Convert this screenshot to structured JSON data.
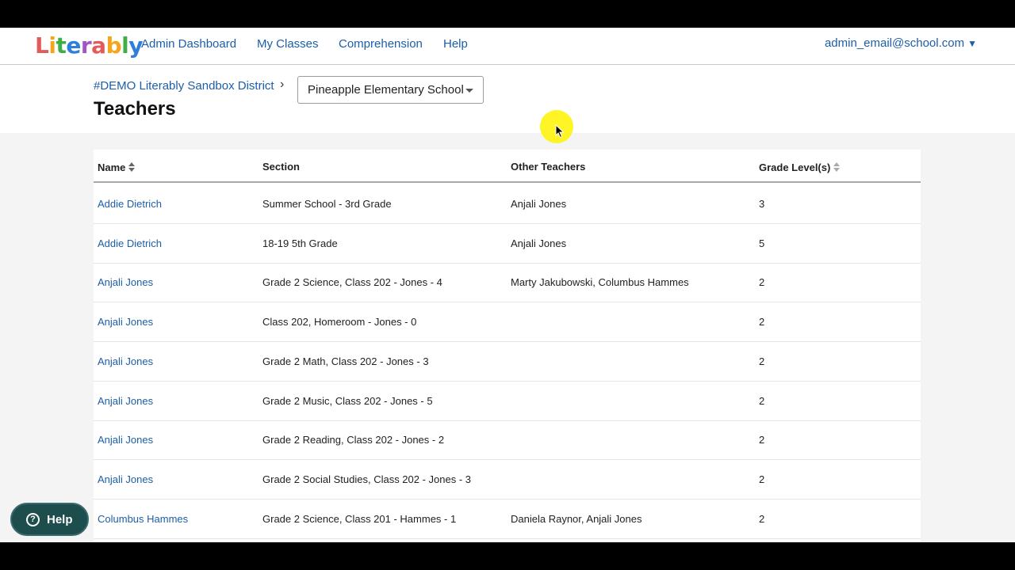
{
  "brand": {
    "logo_letters": [
      "L",
      "i",
      "t",
      "e",
      "r",
      "a",
      "b",
      "l",
      "y"
    ],
    "logo_colors": [
      "#e25b5b",
      "#f4a51c",
      "#3fae49",
      "#2f7ed8",
      "#a355c4",
      "#e25b5b",
      "#f4a51c",
      "#3fae49",
      "#2f7ed8"
    ]
  },
  "nav": {
    "admin_dashboard": "Admin Dashboard",
    "my_classes": "My Classes",
    "comprehension": "Comprehension",
    "help": "Help",
    "account": "admin_email@school.com"
  },
  "header": {
    "breadcrumb": "#DEMO Literably Sandbox District",
    "separator": "›",
    "school_selected": "Pineapple Elementary School",
    "title": "Teachers"
  },
  "table": {
    "columns": [
      "Name",
      "Section",
      "Other Teachers",
      "Grade Level(s)"
    ],
    "rows": [
      {
        "name": "Addie Dietrich",
        "section": "Summer School - 3rd Grade",
        "others": "Anjali Jones",
        "grade": "3"
      },
      {
        "name": "Addie Dietrich",
        "section": "18-19 5th Grade",
        "others": "Anjali Jones",
        "grade": "5"
      },
      {
        "name": "Anjali Jones",
        "section": "Grade 2 Science, Class 202 - Jones - 4",
        "others": "Marty Jakubowski, Columbus Hammes",
        "grade": "2"
      },
      {
        "name": "Anjali Jones",
        "section": "Class 202, Homeroom - Jones - 0",
        "others": "",
        "grade": "2"
      },
      {
        "name": "Anjali Jones",
        "section": "Grade 2 Math, Class 202 - Jones - 3",
        "others": "",
        "grade": "2"
      },
      {
        "name": "Anjali Jones",
        "section": "Grade 2 Music, Class 202 - Jones - 5",
        "others": "",
        "grade": "2"
      },
      {
        "name": "Anjali Jones",
        "section": "Grade 2 Reading, Class 202 - Jones - 2",
        "others": "",
        "grade": "2"
      },
      {
        "name": "Anjali Jones",
        "section": "Grade 2 Social Studies, Class 202 - Jones - 3",
        "others": "",
        "grade": "2"
      },
      {
        "name": "Columbus Hammes",
        "section": "Grade 2 Science, Class 201 - Hammes - 1",
        "others": "Daniela Raynor, Anjali Jones",
        "grade": "2"
      }
    ]
  },
  "help_widget": {
    "label": "Help",
    "icon": "question-circle-icon"
  },
  "colors": {
    "link": "#1c5ea8",
    "help_bg": "#1d4d4c"
  }
}
